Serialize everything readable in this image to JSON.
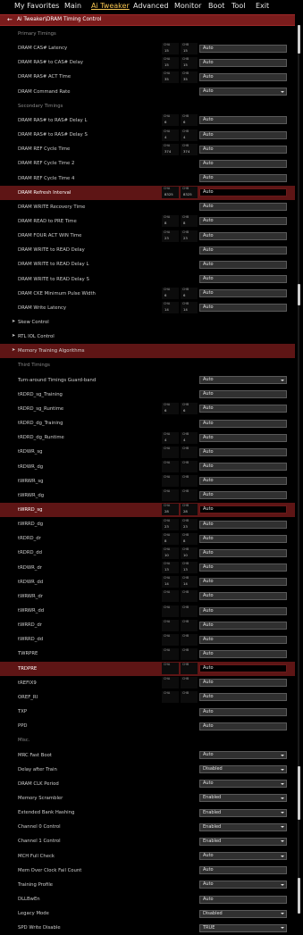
{
  "menu": [
    "My Favorites",
    "Main",
    "Ai Tweaker",
    "Advanced",
    "Monitor",
    "Boot",
    "Tool",
    "Exit"
  ],
  "active_menu": "Ai Tweaker",
  "breadcrumb": "Ai Tweaker\\DRAM Timing Control",
  "back_icon": "arrow-left-icon",
  "accent_color": "#f5c451",
  "highlight_color": "#5e1515",
  "rows": [
    {
      "type": "section",
      "label": "Primary Timings"
    },
    {
      "type": "setting",
      "label": "DRAM CAS# Latency",
      "cha": "15",
      "chb": "15",
      "value": "Auto",
      "dropdown": false,
      "highlight": false
    },
    {
      "type": "setting",
      "label": "DRAM RAS# to CAS# Delay",
      "cha": "15",
      "chb": "15",
      "value": "Auto",
      "dropdown": false,
      "highlight": false
    },
    {
      "type": "setting",
      "label": "DRAM RAS# ACT Time",
      "cha": "35",
      "chb": "35",
      "value": "Auto",
      "dropdown": false,
      "highlight": false
    },
    {
      "type": "setting",
      "label": "DRAM Command Rate",
      "value": "Auto",
      "dropdown": true,
      "highlight": false
    },
    {
      "type": "section",
      "label": "Secondary Timings"
    },
    {
      "type": "setting",
      "label": "DRAM RAS# to RAS# Delay L",
      "cha": "6",
      "chb": "6",
      "value": "Auto",
      "dropdown": false,
      "highlight": false
    },
    {
      "type": "setting",
      "label": "DRAM RAS# to RAS# Delay S",
      "cha": "4",
      "chb": "4",
      "value": "Auto",
      "dropdown": false,
      "highlight": false
    },
    {
      "type": "setting",
      "label": "DRAM REF Cycle Time",
      "cha": "374",
      "chb": "374",
      "value": "Auto",
      "dropdown": false,
      "highlight": false
    },
    {
      "type": "setting",
      "label": "DRAM REF Cycle Time 2",
      "value": "Auto",
      "dropdown": false,
      "highlight": false
    },
    {
      "type": "setting",
      "label": "DRAM REF Cycle Time 4",
      "value": "Auto",
      "dropdown": false,
      "highlight": false
    },
    {
      "type": "setting",
      "label": "DRAM Refresh Interval",
      "cha": "8325",
      "chb": "8325",
      "value": "Auto",
      "dropdown": false,
      "highlight": true
    },
    {
      "type": "setting",
      "label": "DRAM WRITE Recovery Time",
      "value": "Auto",
      "dropdown": false,
      "highlight": false
    },
    {
      "type": "setting",
      "label": "DRAM READ to PRE Time",
      "cha": "8",
      "chb": "8",
      "value": "Auto",
      "dropdown": false,
      "highlight": false
    },
    {
      "type": "setting",
      "label": "DRAM FOUR ACT WIN Time",
      "cha": "23",
      "chb": "23",
      "value": "Auto",
      "dropdown": false,
      "highlight": false
    },
    {
      "type": "setting",
      "label": "DRAM WRITE to READ Delay",
      "value": "Auto",
      "dropdown": false,
      "highlight": false
    },
    {
      "type": "setting",
      "label": "DRAM WRITE to READ Delay L",
      "value": "Auto",
      "dropdown": false,
      "highlight": false
    },
    {
      "type": "setting",
      "label": "DRAM WRITE to READ Delay S",
      "value": "Auto",
      "dropdown": false,
      "highlight": false
    },
    {
      "type": "setting",
      "label": "DRAM CKE Minimum Pulse Width",
      "cha": "6",
      "chb": "6",
      "value": "Auto",
      "dropdown": false,
      "highlight": false
    },
    {
      "type": "setting",
      "label": "DRAM Write Latency",
      "cha": "14",
      "chb": "14",
      "value": "Auto",
      "dropdown": false,
      "highlight": false
    },
    {
      "type": "group",
      "label": "Skew Control",
      "highlight": false
    },
    {
      "type": "group",
      "label": "RTL IOL Control",
      "highlight": false
    },
    {
      "type": "group",
      "label": "Memory Training Algorithms",
      "highlight": true
    },
    {
      "type": "section",
      "label": "Third Timings"
    },
    {
      "type": "setting",
      "label": "Turn-around Timings Guard-band",
      "value": "Auto",
      "dropdown": true,
      "highlight": false
    },
    {
      "type": "setting",
      "label": "tRDRD_sg_Training",
      "value": "Auto",
      "dropdown": false,
      "highlight": false
    },
    {
      "type": "setting",
      "label": "tRDRD_sg_Runtime",
      "cha": "6",
      "chb": "6",
      "value": "Auto",
      "dropdown": false,
      "highlight": false
    },
    {
      "type": "setting",
      "label": "tRDRD_dg_Training",
      "value": "Auto",
      "dropdown": false,
      "highlight": false
    },
    {
      "type": "setting",
      "label": "tRDRD_dg_Runtime",
      "cha": "4",
      "chb": "4",
      "value": "Auto",
      "dropdown": false,
      "highlight": false
    },
    {
      "type": "setting",
      "label": "tRDWR_sg",
      "cha": "",
      "chb": "",
      "value": "Auto",
      "dropdown": false,
      "highlight": false
    },
    {
      "type": "setting",
      "label": "tRDWR_dg",
      "cha": "",
      "chb": "",
      "value": "Auto",
      "dropdown": false,
      "highlight": false
    },
    {
      "type": "setting",
      "label": "tWRWR_sg",
      "cha": "",
      "chb": "",
      "value": "Auto",
      "dropdown": false,
      "highlight": false
    },
    {
      "type": "setting",
      "label": "tWRWR_dg",
      "cha": "",
      "chb": "",
      "value": "Auto",
      "dropdown": false,
      "highlight": false
    },
    {
      "type": "setting",
      "label": "tWRRD_sg",
      "cha": "28",
      "chb": "28",
      "value": "Auto",
      "dropdown": false,
      "highlight": true
    },
    {
      "type": "setting",
      "label": "tWRRD_dg",
      "cha": "23",
      "chb": "23",
      "value": "Auto",
      "dropdown": false,
      "highlight": false
    },
    {
      "type": "setting",
      "label": "tRDRD_dr",
      "cha": "8",
      "chb": "8",
      "value": "Auto",
      "dropdown": false,
      "highlight": false
    },
    {
      "type": "setting",
      "label": "tRDRD_dd",
      "cha": "10",
      "chb": "10",
      "value": "Auto",
      "dropdown": false,
      "highlight": false
    },
    {
      "type": "setting",
      "label": "tRDWR_dr",
      "cha": "13",
      "chb": "13",
      "value": "Auto",
      "dropdown": false,
      "highlight": false
    },
    {
      "type": "setting",
      "label": "tRDWR_dd",
      "cha": "14",
      "chb": "14",
      "value": "Auto",
      "dropdown": false,
      "highlight": false
    },
    {
      "type": "setting",
      "label": "tWRWR_dr",
      "cha": "",
      "chb": "",
      "value": "Auto",
      "dropdown": false,
      "highlight": false
    },
    {
      "type": "setting",
      "label": "tWRWR_dd",
      "cha": "",
      "chb": "",
      "value": "Auto",
      "dropdown": false,
      "highlight": false
    },
    {
      "type": "setting",
      "label": "tWRRD_dr",
      "cha": "",
      "chb": "",
      "value": "Auto",
      "dropdown": false,
      "highlight": false
    },
    {
      "type": "setting",
      "label": "tWRRD_dd",
      "cha": "",
      "chb": "",
      "value": "Auto",
      "dropdown": false,
      "highlight": false
    },
    {
      "type": "setting",
      "label": "TWRPRE",
      "cha": "",
      "chb": "",
      "value": "Auto",
      "dropdown": false,
      "highlight": false
    },
    {
      "type": "setting",
      "label": "TRDPRE",
      "cha": "",
      "chb": "",
      "value": "Auto",
      "dropdown": false,
      "highlight": true
    },
    {
      "type": "setting",
      "label": "tREFIX9",
      "cha": "",
      "chb": "",
      "value": "Auto",
      "dropdown": false,
      "highlight": false
    },
    {
      "type": "setting",
      "label": "OREF_RI",
      "cha": "",
      "chb": "",
      "value": "Auto",
      "dropdown": false,
      "highlight": false
    },
    {
      "type": "setting",
      "label": "TXP",
      "value": "Auto",
      "dropdown": false,
      "highlight": false
    },
    {
      "type": "setting",
      "label": "PPD",
      "value": "Auto",
      "dropdown": false,
      "highlight": false
    },
    {
      "type": "section",
      "label": "Misc."
    },
    {
      "type": "setting",
      "label": "MRC Fast Boot",
      "value": "Auto",
      "dropdown": true,
      "highlight": false
    },
    {
      "type": "setting",
      "label": "Delay after Train",
      "value": "Disabled",
      "dropdown": true,
      "highlight": false
    },
    {
      "type": "setting",
      "label": "DRAM CLK Period",
      "value": "Auto",
      "dropdown": true,
      "highlight": false
    },
    {
      "type": "setting",
      "label": "Memory Scrambler",
      "value": "Enabled",
      "dropdown": true,
      "highlight": false
    },
    {
      "type": "setting",
      "label": "Extended Bank Hashing",
      "value": "Enabled",
      "dropdown": true,
      "highlight": false
    },
    {
      "type": "setting",
      "label": "Channel 0 Control",
      "value": "Enabled",
      "dropdown": true,
      "highlight": false
    },
    {
      "type": "setting",
      "label": "Channel 1 Control",
      "value": "Enabled",
      "dropdown": true,
      "highlight": false
    },
    {
      "type": "setting",
      "label": "MCH Full Check",
      "value": "Auto",
      "dropdown": true,
      "highlight": false
    },
    {
      "type": "setting",
      "label": "Mem Over Clock Fail Count",
      "value": "Auto",
      "dropdown": false,
      "highlight": false
    },
    {
      "type": "setting",
      "label": "Training Profile",
      "value": "Auto",
      "dropdown": true,
      "highlight": false
    },
    {
      "type": "setting",
      "label": "DLLBwEn",
      "value": "Auto",
      "dropdown": false,
      "highlight": false
    },
    {
      "type": "setting",
      "label": "Legacy Mode",
      "value": "Disabled",
      "dropdown": true,
      "highlight": false
    },
    {
      "type": "setting",
      "label": "SPD Write Disable",
      "value": "TRUE",
      "dropdown": true,
      "highlight": false
    }
  ]
}
